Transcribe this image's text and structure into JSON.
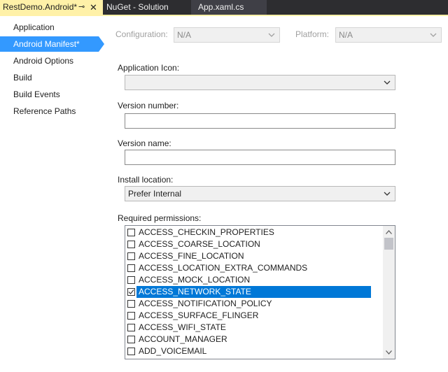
{
  "tabs": {
    "active_label": "RestDemo.Android*",
    "pin_glyph": "⊸",
    "close_glyph": "✕",
    "items": [
      {
        "label": "NuGet - Solution"
      },
      {
        "label": "App.xaml.cs"
      }
    ]
  },
  "sidebar": {
    "items": [
      {
        "label": "Application"
      },
      {
        "label": "Android Manifest*"
      },
      {
        "label": "Android Options"
      },
      {
        "label": "Build"
      },
      {
        "label": "Build Events"
      },
      {
        "label": "Reference Paths"
      }
    ],
    "selected_index": 1
  },
  "config": {
    "configuration_label": "Configuration:",
    "configuration_value": "N/A",
    "platform_label": "Platform:",
    "platform_value": "N/A"
  },
  "form": {
    "app_icon_label": "Application Icon:",
    "app_icon_value": "",
    "version_number_label": "Version number:",
    "version_number_value": "",
    "version_name_label": "Version name:",
    "version_name_value": "",
    "install_location_label": "Install location:",
    "install_location_value": "Prefer Internal",
    "permissions_label": "Required permissions:"
  },
  "permissions": [
    {
      "name": "ACCESS_CHECKIN_PROPERTIES",
      "checked": false,
      "selected": false
    },
    {
      "name": "ACCESS_COARSE_LOCATION",
      "checked": false,
      "selected": false
    },
    {
      "name": "ACCESS_FINE_LOCATION",
      "checked": false,
      "selected": false
    },
    {
      "name": "ACCESS_LOCATION_EXTRA_COMMANDS",
      "checked": false,
      "selected": false
    },
    {
      "name": "ACCESS_MOCK_LOCATION",
      "checked": false,
      "selected": false
    },
    {
      "name": "ACCESS_NETWORK_STATE",
      "checked": true,
      "selected": true
    },
    {
      "name": "ACCESS_NOTIFICATION_POLICY",
      "checked": false,
      "selected": false
    },
    {
      "name": "ACCESS_SURFACE_FLINGER",
      "checked": false,
      "selected": false
    },
    {
      "name": "ACCESS_WIFI_STATE",
      "checked": false,
      "selected": false
    },
    {
      "name": "ACCOUNT_MANAGER",
      "checked": false,
      "selected": false
    },
    {
      "name": "ADD_VOICEMAIL",
      "checked": false,
      "selected": false
    }
  ],
  "colors": {
    "active_tab": "#fff1a8",
    "selection": "#3399ff",
    "list_selection": "#0078d7",
    "tab_strip": "#2d2d30"
  }
}
